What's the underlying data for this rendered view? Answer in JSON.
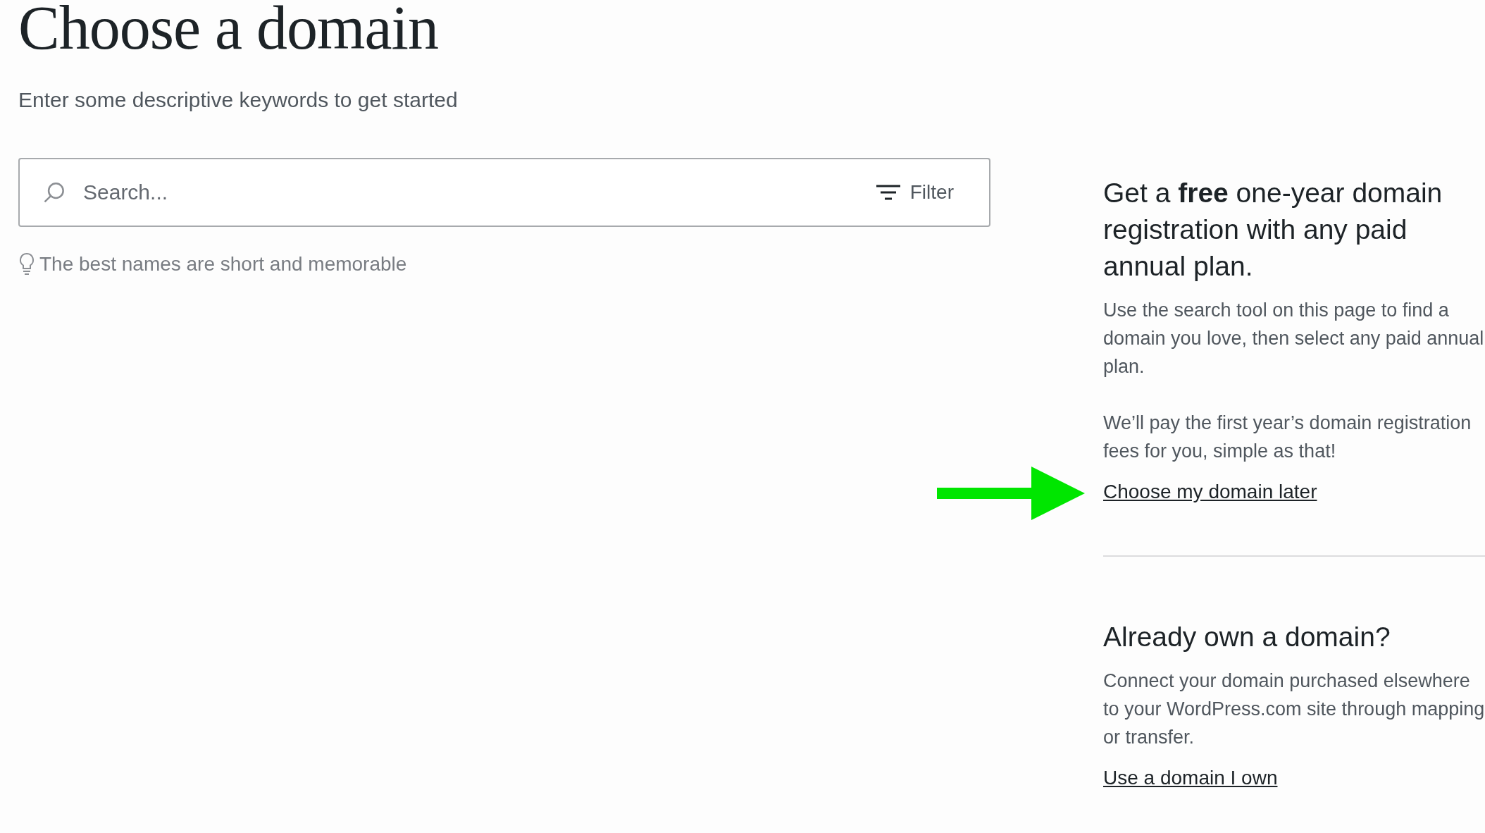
{
  "header": {
    "title": "Choose a domain",
    "subtitle": "Enter some descriptive keywords to get started"
  },
  "search": {
    "placeholder": "Search...",
    "filter_label": "Filter"
  },
  "tip": "The best names are short and memorable",
  "offer": {
    "heading": "Get a **free** one-year domain registration with any paid annual plan.",
    "paragraphs": [
      "Use the search tool on this page to find a domain you love, then select any paid annual plan.",
      "We’ll pay the first year’s domain registration fees for you, simple as that!"
    ],
    "link": "Choose my domain later"
  },
  "own_domain": {
    "heading": "Already own a domain?",
    "paragraphs": [
      "Connect your domain purchased elsewhere to your WordPress.com site through mapping or transfer."
    ],
    "link": "Use a domain I own"
  }
}
